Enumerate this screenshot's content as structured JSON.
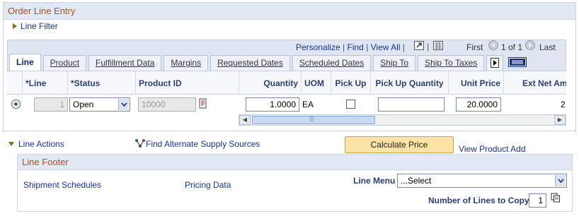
{
  "order_line_entry": {
    "title": "Order Line Entry",
    "line_filter": "Line Filter"
  },
  "nav": {
    "personalize": "Personalize",
    "find": "Find",
    "view_all": "View All",
    "first": "First",
    "pagination": "1 of 1",
    "last": "Last"
  },
  "tabs": [
    {
      "label": "Line",
      "active": true
    },
    {
      "label": "Product"
    },
    {
      "label": "Fulfillment Data"
    },
    {
      "label": "Margins"
    },
    {
      "label": "Requested Dates"
    },
    {
      "label": "Scheduled Dates"
    },
    {
      "label": "Ship To"
    },
    {
      "label": "Ship To Taxes"
    }
  ],
  "columns": {
    "line": "*Line",
    "status": "*Status",
    "product_id": "Product ID",
    "quantity": "Quantity",
    "uom": "UOM",
    "pick_up": "Pick Up",
    "pick_up_quantity": "Pick Up Quantity",
    "unit_price": "Unit Price",
    "ext_net_amount": "Ext Net Amo"
  },
  "row": {
    "line": "1",
    "status": "Open",
    "product_id": "10000",
    "quantity": "1.0000",
    "uom": "EA",
    "pick_up_quantity": "",
    "unit_price": "20.0000",
    "ext_net_amount": "2"
  },
  "actions": {
    "line_actions": "Line Actions",
    "find_alternate": "Find Alternate Supply Sources",
    "calculate_price": "Calculate Price",
    "view_product_add": "View Product Add"
  },
  "line_footer": {
    "title": "Line Footer",
    "shipment_schedules": "Shipment Schedules",
    "pricing_data": "Pricing Data",
    "line_menu_label": "Line Menu",
    "line_menu_value": "...Select",
    "lines_to_copy_label": "Number of Lines to Copy",
    "lines_to_copy_value": "1"
  }
}
